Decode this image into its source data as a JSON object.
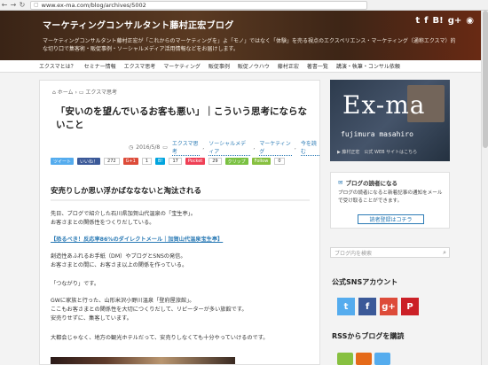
{
  "browser": {
    "url": "www.ex-ma.com/blog/archives/5002"
  },
  "header": {
    "title": "マーケティングコンサルタント藤村正宏ブログ",
    "description": "マーケティングコンサルタント藤村正宏が「これからのマーケティングを」よ「モノ」ではなく「体験」を売る視点のエクスペリエンス・マーケティング（通称エクスマ）的な切り口で集客術・販促事例・ソーシャルメディア活用情報などをお届けします。",
    "social": [
      "t",
      "f",
      "B!",
      "g+",
      "rss"
    ]
  },
  "menu": [
    "エクスマとは？",
    "セミナー情報",
    "エクスマ思考",
    "マーケティング",
    "販促事例",
    "販促ノウハウ",
    "藤村正宏",
    "著書一覧",
    "講演・執筆・コンサル依頼"
  ],
  "post": {
    "breadcrumb_home": "ホーム",
    "breadcrumb_cat": "エクスマ思考",
    "title": "「安いのを望んでいるお客も悪い」｜こういう思考にならないこと",
    "date": "2016/5/8",
    "tags": [
      "エクスマ思考",
      "ソーシャルメディア",
      "マーケティング",
      "今を読む"
    ],
    "share": {
      "tweet": "ツイート",
      "like": "いいね！",
      "like_count": "272",
      "gplus": "G+1",
      "gplus_count": "1",
      "hatena_count": "17",
      "pocket": "Pocket",
      "pocket_count": "29",
      "clip": "クリップ",
      "follow": "Follow",
      "follow_count": "0"
    },
    "section_heading": "安売りしか思い浮かばななないと淘汰される",
    "p1a": "先日、ブログで紹介した石川県加賀山代温泉の「宝生亭」。",
    "p1b": "お客さまとの関係性をつくりだしている。",
    "link": "【恐るべき！反応率86%のダイレクトメール｜加賀山代温泉宝生亭】",
    "p2a": "創造性あふれるお手紙（DM）やブログとSNSの発信。",
    "p2b": "お客さまとの間に、お客さま以上の関係を作っている。",
    "p3": "「つながり」です。",
    "p4a": "GWに家族と行った、山形米沢小野川温泉「登府屋旅館」。",
    "p4b": "ここもお客さまとの関係性を大切につくりだして、リピーターが多い旅館です。",
    "p4c": "安売りせずに、集客しています。",
    "p5": "大都会じゃなく、地方の観光ホテルだって、安売りしなくても十分やっていけるのです。"
  },
  "sidebar": {
    "banner_title": "Ex-ma",
    "banner_name": "fujimura masahiro",
    "banner_caption": "▶ 藤村正宏　公式 WEB サイトはこちら",
    "reader_title": "ブログの読者になる",
    "reader_text": "ブログの読者になると新着記事の通知をメールで受け取ることができます。",
    "reader_button": "読者登録はコチラ",
    "search_placeholder": "ブログ内を検索",
    "sns_title": "公式SNSアカウント",
    "rss_title": "RSSからブログを購読"
  }
}
